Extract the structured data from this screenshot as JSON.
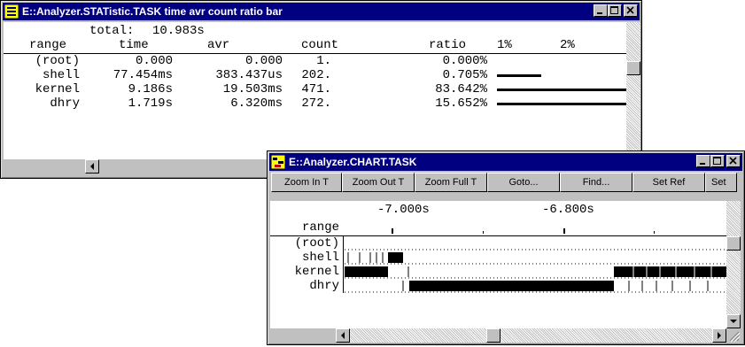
{
  "stat_window": {
    "title": "E::Analyzer.STATistic.TASK time avr count ratio bar",
    "total_label": "total:",
    "total_value": "10.983s",
    "headers": {
      "range": "range",
      "time": "time",
      "avr": "avr",
      "count": "count",
      "ratio": "ratio",
      "pct1": "1%",
      "pct2": "2%"
    },
    "rows": [
      {
        "range": "(root)",
        "time": "0.000",
        "avr": "0.000",
        "count": "1.",
        "ratio": "0.000%",
        "bar": 0
      },
      {
        "range": "shell",
        "time": "77.454ms",
        "avr": "383.437us",
        "count": "202.",
        "ratio": "0.705%",
        "bar": 0.705
      },
      {
        "range": "kernel",
        "time": "9.186s",
        "avr": "19.503ms",
        "count": "471.",
        "ratio": "83.642%",
        "bar": 83.642
      },
      {
        "range": "dhry",
        "time": "1.719s",
        "avr": "6.320ms",
        "count": "272.",
        "ratio": "15.652%",
        "bar": 15.652
      }
    ]
  },
  "chart_window": {
    "title": "E::Analyzer.CHART.TASK",
    "toolbar": [
      "Zoom In T",
      "Zoom Out T",
      "Zoom Full T",
      "Goto...",
      "Find...",
      "Set Ref",
      "Set"
    ],
    "time_left": "-7.000s",
    "time_right": "-6.800s",
    "range_label": "range",
    "rows": [
      "(root)",
      "shell",
      "kernel",
      "dhry"
    ]
  },
  "window_controls": {
    "minimize": "_",
    "maximize": "□",
    "close": "×"
  },
  "icons": {
    "stat_icon": "list-icon",
    "chart_icon": "chart-icon"
  },
  "colors": {
    "titlebar": "#000080",
    "face": "#c0c0c0",
    "content": "#ffffff"
  }
}
